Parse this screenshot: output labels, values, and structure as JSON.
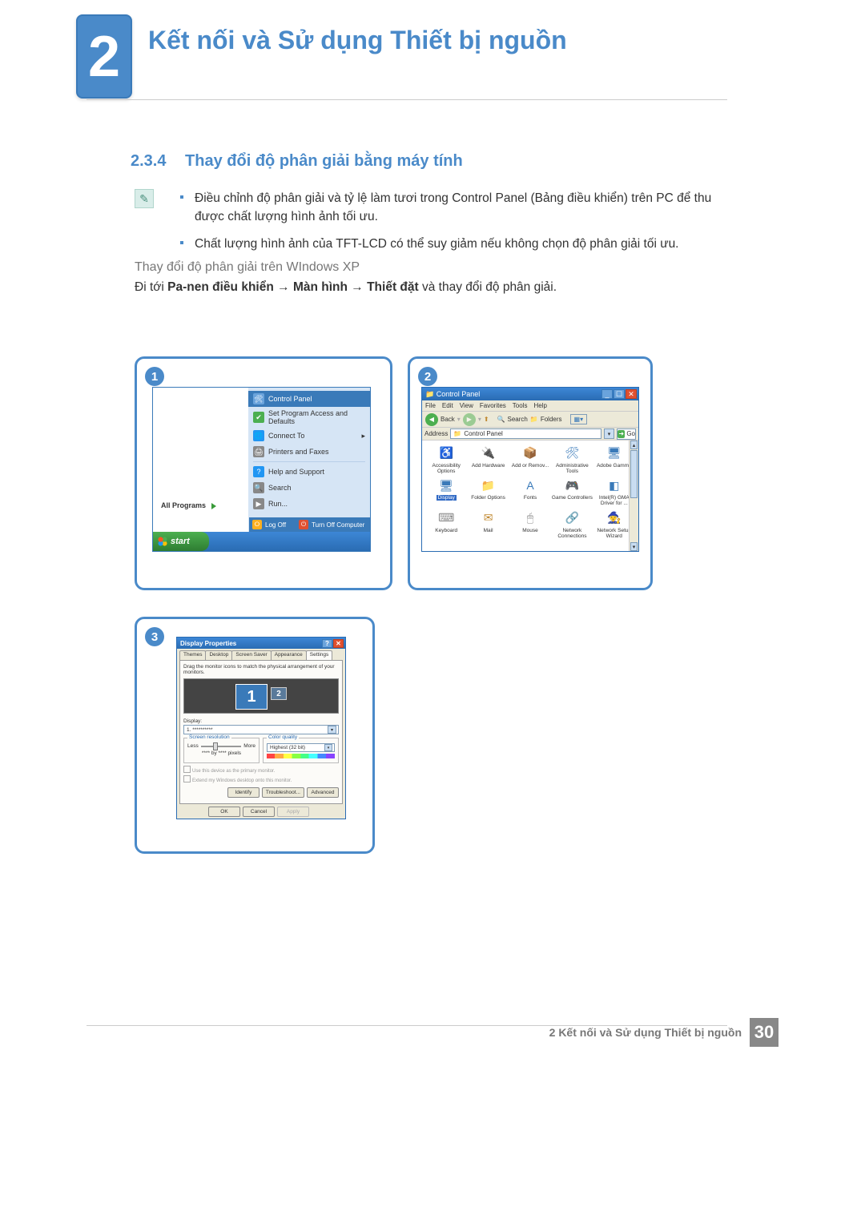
{
  "chapter": {
    "number": "2",
    "title": "Kết nối và Sử dụng Thiết bị nguồn"
  },
  "section": {
    "number": "2.3.4",
    "title": "Thay đổi độ phân giải bằng máy tính"
  },
  "note_icon_glyph": "✎",
  "bullets": [
    "Điều chỉnh độ phân giải và tỷ lệ làm tươi trong Control Panel (Bảng điều khiển) trên PC để thu được chất lượng hình ảnh tối ưu.",
    "Chất lượng hình ảnh của TFT-LCD có thể suy giảm nếu không chọn độ phân giải tối ưu."
  ],
  "subheading": "Thay đổi độ phân giải trên WIndows XP",
  "instruction": {
    "prefix": "Đi tới ",
    "b1": "Pa-nen điều khiển",
    "arrow": " → ",
    "b2": "Màn hình",
    "b3": "Thiết đặt",
    "suffix": " và thay đổi độ phân giải."
  },
  "fig1": {
    "step": "1",
    "right_items": [
      {
        "label": "Control Panel",
        "hl": true,
        "glyph": "🛠",
        "bg": "#6aa3dc"
      },
      {
        "label": "Set Program Access and Defaults",
        "glyph": "✔",
        "bg": "#4caf50"
      },
      {
        "label": "Connect To",
        "glyph": "🌐",
        "bg": "#2196f3",
        "arrow": true
      },
      {
        "label": "Printers and Faxes",
        "glyph": "🖨",
        "bg": "#888"
      },
      {
        "label": "Help and Support",
        "glyph": "?",
        "bg": "#2196f3",
        "sep_before": true
      },
      {
        "label": "Search",
        "glyph": "🔍",
        "bg": "#888"
      },
      {
        "label": "Run...",
        "glyph": "▶",
        "bg": "#888"
      }
    ],
    "all_programs": "All Programs",
    "log_off": "Log Off",
    "turn_off": "Turn Off Computer",
    "start": "start"
  },
  "fig2": {
    "step": "2",
    "title": "Control Panel",
    "menus": [
      "File",
      "Edit",
      "View",
      "Favorites",
      "Tools",
      "Help"
    ],
    "toolbar": {
      "back": "Back",
      "search": "Search",
      "folders": "Folders"
    },
    "address_label": "Address",
    "address_value": "Control Panel",
    "go": "Go",
    "icons": [
      {
        "label": "Accessibility Options",
        "glyph": "♿",
        "color": "#2e7d32"
      },
      {
        "label": "Add Hardware",
        "glyph": "🔌",
        "color": "#888"
      },
      {
        "label": "Add or Remov...",
        "glyph": "📦",
        "color": "#c08830"
      },
      {
        "label": "Administrative Tools",
        "glyph": "🛠",
        "color": "#3a7ab9"
      },
      {
        "label": "Adobe Gamma",
        "glyph": "🖥",
        "color": "#3a7ab9"
      },
      {
        "label": "Display",
        "glyph": "🖥",
        "color": "#3a7ab9",
        "selected": true
      },
      {
        "label": "Folder Options",
        "glyph": "📁",
        "color": "#c08830"
      },
      {
        "label": "Fonts",
        "glyph": "A",
        "color": "#3a7ab9"
      },
      {
        "label": "Game Controllers",
        "glyph": "🎮",
        "color": "#888"
      },
      {
        "label": "Intel(R) GMA Driver for ...",
        "glyph": "◧",
        "color": "#3a7ab9"
      },
      {
        "label": "Keyboard",
        "glyph": "⌨",
        "color": "#888"
      },
      {
        "label": "Mail",
        "glyph": "✉",
        "color": "#c08830"
      },
      {
        "label": "Mouse",
        "glyph": "🖱",
        "color": "#888"
      },
      {
        "label": "Network Connections",
        "glyph": "🔗",
        "color": "#3a7ab9"
      },
      {
        "label": "Network Setup Wizard",
        "glyph": "🧙",
        "color": "#3a7ab9"
      }
    ]
  },
  "fig3": {
    "step": "3",
    "title": "Display Properties",
    "tabs": [
      "Themes",
      "Desktop",
      "Screen Saver",
      "Appearance",
      "Settings"
    ],
    "active_tab": "Settings",
    "hint": "Drag the monitor icons to match the physical arrangement of your monitors.",
    "monitor1": "1",
    "monitor2": "2",
    "display_label": "Display:",
    "display_value": "1. **********",
    "screen_res_label": "Screen resolution",
    "less": "Less",
    "more": "More",
    "res_value": "**** by **** pixels",
    "color_quality_label": "Color quality",
    "color_quality_value": "Highest (32 bit)",
    "chk1": "Use this device as the primary monitor.",
    "chk2": "Extend my Windows desktop onto this monitor.",
    "buttons_mid": [
      "Identify",
      "Troubleshoot...",
      "Advanced"
    ],
    "buttons_bottom": [
      "OK",
      "Cancel",
      "Apply"
    ]
  },
  "footer": {
    "text": "2 Kết nối và Sử dụng Thiết bị nguồn",
    "page": "30"
  }
}
